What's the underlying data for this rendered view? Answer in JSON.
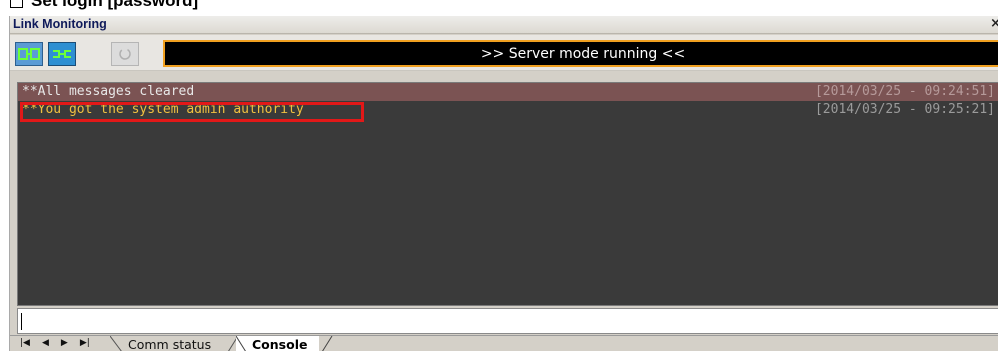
{
  "doc": {
    "heading": "Set login [password]"
  },
  "window": {
    "title": "Link Monitoring",
    "close_glyph": "×"
  },
  "toolbar": {
    "buttons": [
      {
        "icon": "link-connect-icon",
        "state": "active"
      },
      {
        "icon": "link-plug-icon",
        "state": "active"
      },
      {
        "icon": "refresh-icon",
        "state": "disabled"
      }
    ],
    "status_text": ">> Server mode running <<"
  },
  "console": {
    "messages": [
      {
        "text": "**All messages cleared",
        "time": "[2014/03/25 - 09:24:51]"
      },
      {
        "text": "**You got the system admin authority",
        "time": "[2014/03/25 - 09:25:21]"
      }
    ]
  },
  "input": {
    "value": ""
  },
  "tabs": {
    "items": [
      {
        "label": "Comm status"
      },
      {
        "label": "Console"
      }
    ],
    "active": "Console"
  },
  "colors": {
    "accent_border": "#f0a020",
    "highlight": "#e21818",
    "message_highlight": "#f0c040"
  }
}
